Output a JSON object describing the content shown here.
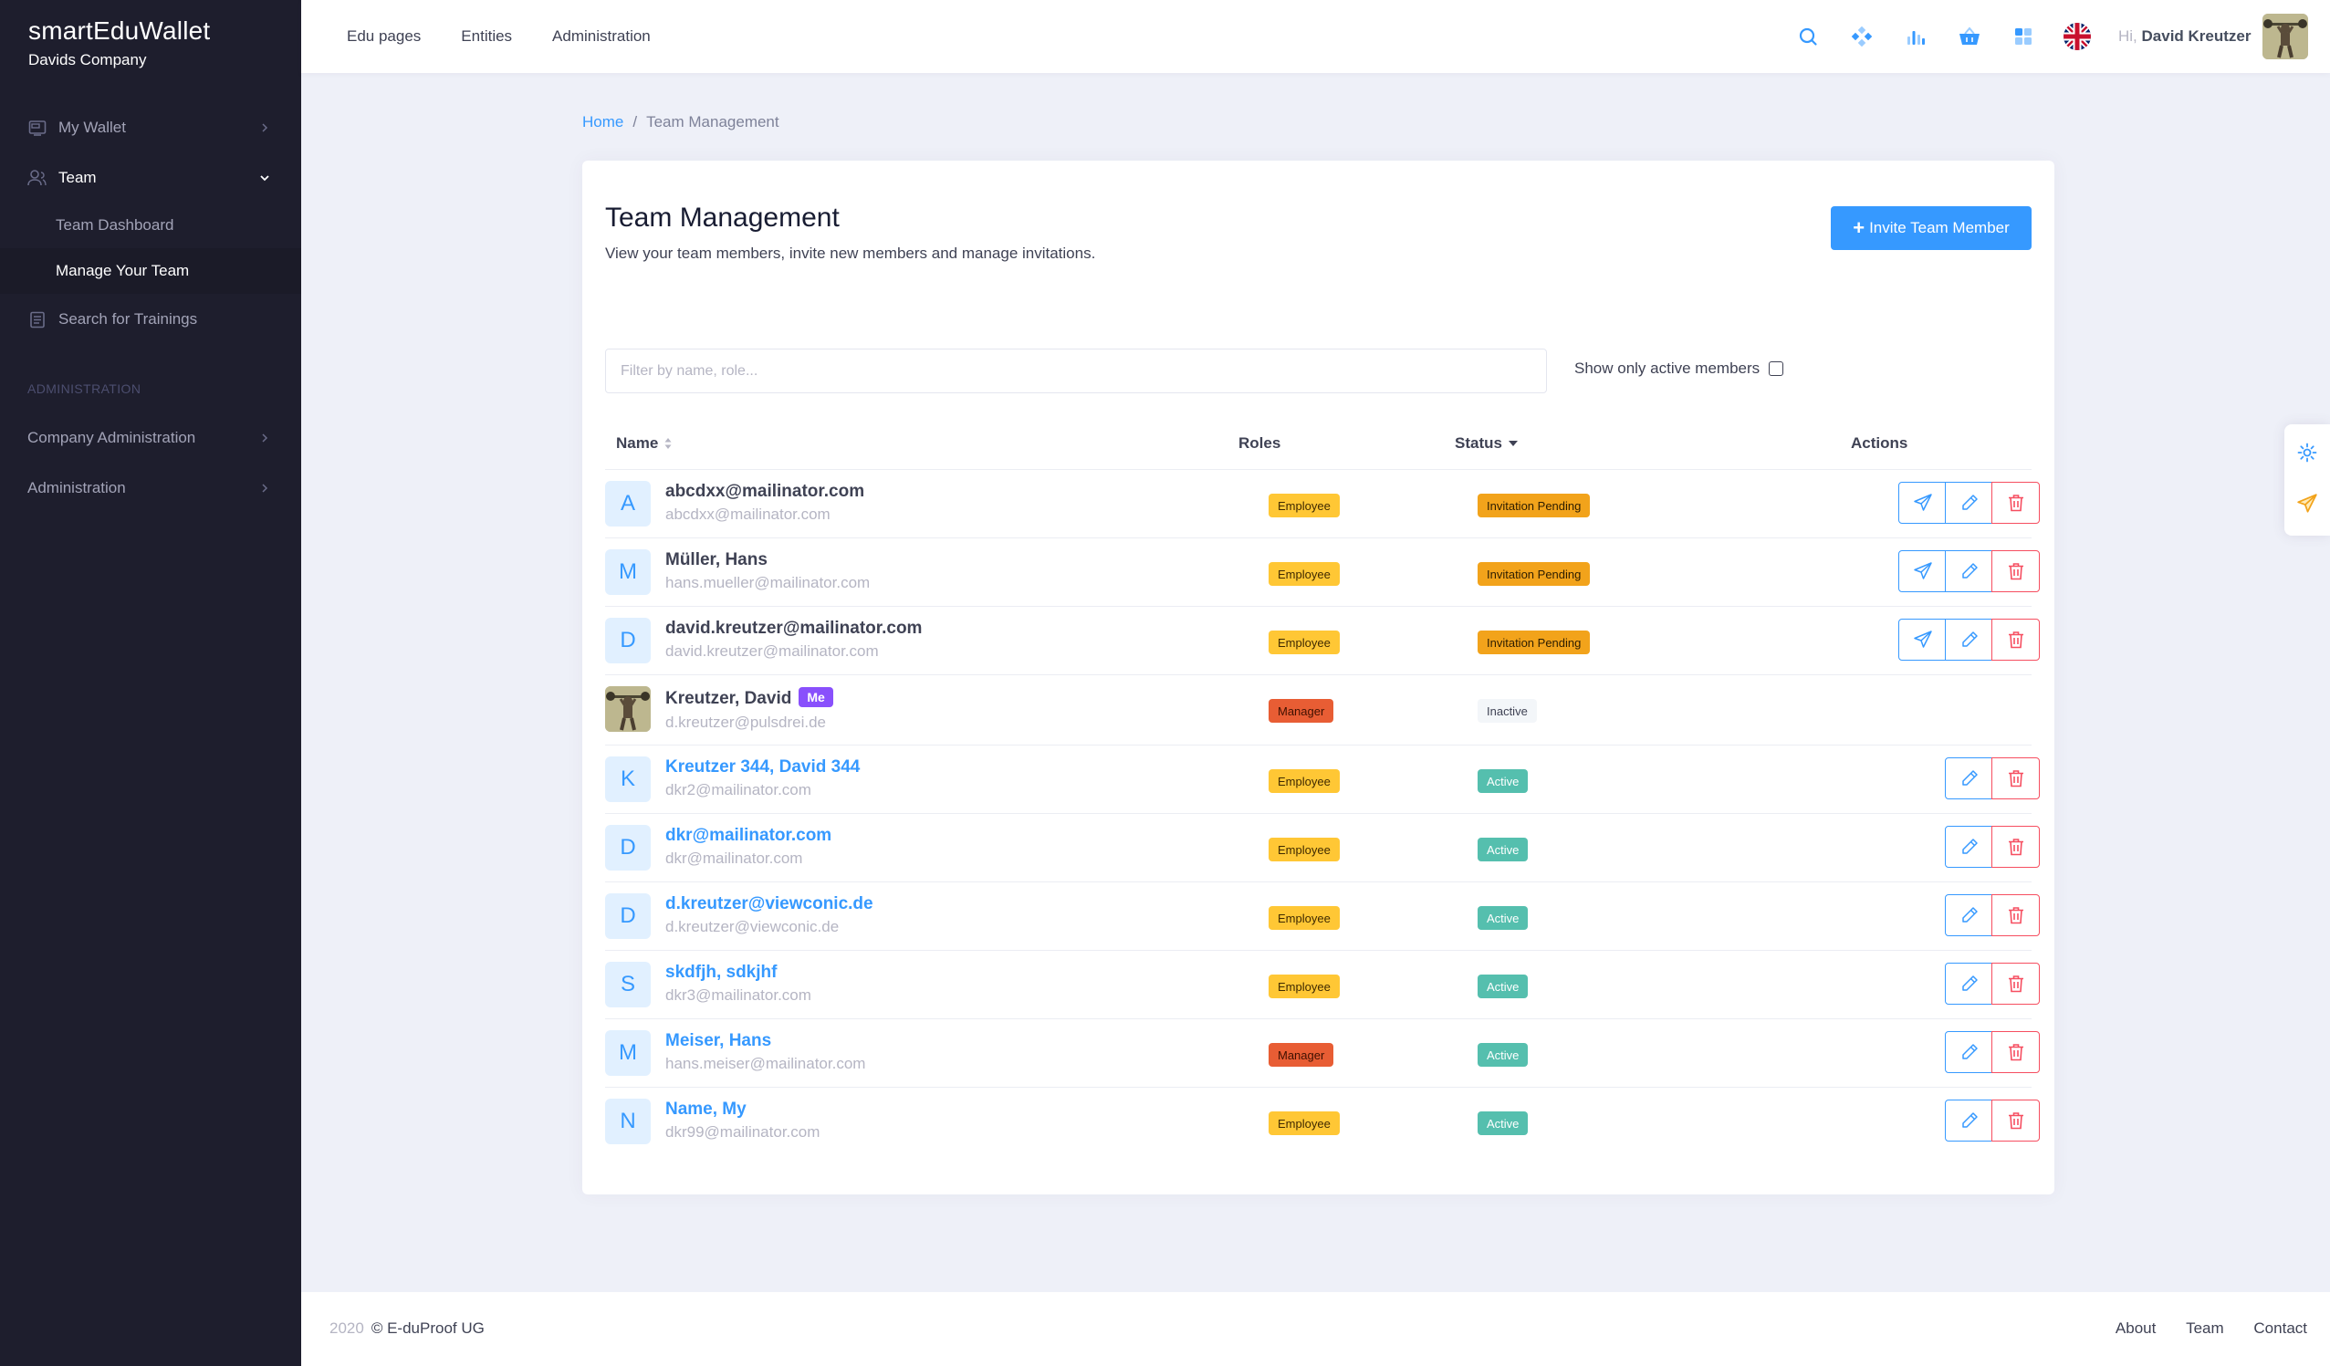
{
  "brand": {
    "title": "smartEduWallet",
    "subtitle": "Davids Company"
  },
  "sidebar": {
    "items": [
      {
        "label": "My Wallet"
      },
      {
        "label": "Team"
      },
      {
        "label": "Team Dashboard"
      },
      {
        "label": "Manage Your Team"
      },
      {
        "label": "Search for Trainings"
      },
      {
        "label": "Company Administration"
      },
      {
        "label": "Administration"
      }
    ],
    "section_label": "ADMINISTRATION"
  },
  "header": {
    "nav": [
      "Edu pages",
      "Entities",
      "Administration"
    ],
    "greeting_prefix": "Hi,",
    "user_name": "David Kreutzer"
  },
  "breadcrumb": {
    "home": "Home",
    "separator": "/",
    "current": "Team Management"
  },
  "page": {
    "title": "Team Management",
    "subtitle": "View your team members, invite new members and manage invitations.",
    "invite_button": "Invite Team Member",
    "filter_placeholder": "Filter by name, role...",
    "filter_value": "",
    "active_only_label": "Show only active members",
    "active_only_checked": false
  },
  "table": {
    "columns": [
      "Name",
      "Roles",
      "Status",
      "Actions"
    ],
    "me_badge": "Me",
    "rows": [
      {
        "initial": "A",
        "name": "abcdxx@mailinator.com",
        "email": "abcdxx@mailinator.com",
        "role": "Employee",
        "status": "Invitation Pending"
      },
      {
        "initial": "M",
        "name": "Müller, Hans",
        "email": "hans.mueller@mailinator.com",
        "role": "Employee",
        "status": "Invitation Pending"
      },
      {
        "initial": "D",
        "name": "david.kreutzer@mailinator.com",
        "email": "david.kreutzer@mailinator.com",
        "role": "Employee",
        "status": "Invitation Pending"
      },
      {
        "initial": "",
        "name": "Kreutzer, David",
        "email": "d.kreutzer@pulsdrei.de",
        "role": "Manager",
        "status": "Inactive"
      },
      {
        "initial": "K",
        "name": "Kreutzer 344, David 344",
        "email": "dkr2@mailinator.com",
        "role": "Employee",
        "status": "Active"
      },
      {
        "initial": "D",
        "name": "dkr@mailinator.com",
        "email": "dkr@mailinator.com",
        "role": "Employee",
        "status": "Active"
      },
      {
        "initial": "D",
        "name": "d.kreutzer@viewconic.de",
        "email": "d.kreutzer@viewconic.de",
        "role": "Employee",
        "status": "Active"
      },
      {
        "initial": "S",
        "name": "skdfjh, sdkjhf",
        "email": "dkr3@mailinator.com",
        "role": "Employee",
        "status": "Active"
      },
      {
        "initial": "M",
        "name": "Meiser, Hans",
        "email": "hans.meiser@mailinator.com",
        "role": "Manager",
        "status": "Active"
      },
      {
        "initial": "N",
        "name": "Name, My",
        "email": "dkr99@mailinator.com",
        "role": "Employee",
        "status": "Active"
      }
    ]
  },
  "footer": {
    "year": "2020",
    "company": "© E-duProof UG",
    "links": [
      "About",
      "Team",
      "Contact"
    ]
  },
  "colors": {
    "primary": "#3699ff",
    "danger": "#f64e60",
    "warning": "#ffc735",
    "pending": "#f2a31b",
    "manager": "#e85d34",
    "success": "#55bfae",
    "sidebar_bg": "#1e1e2d"
  }
}
